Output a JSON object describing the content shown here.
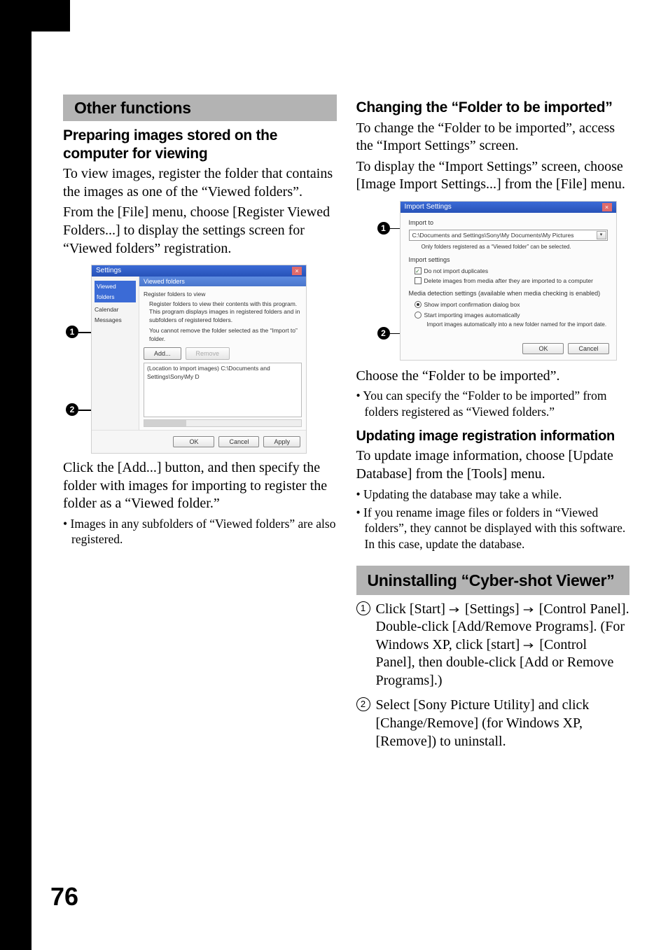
{
  "pageNumber": "76",
  "left": {
    "sectionTitle": "Other functions",
    "subTitle": "Preparing images stored on the computer for viewing",
    "para1": "To view images, register the folder that contains the images as one of the “Viewed folders”.",
    "para2": "From the [File] menu, choose [Register Viewed Folders...] to display the settings screen for “Viewed folders” registration.",
    "para3": "Click the [Add...] button, and then specify the folder with images for importing to register the folder as a “Viewed folder.”",
    "bullet1": "Images in any subfolders of “Viewed folders” are also registered.",
    "shot": {
      "title": "Settings",
      "sidebar": {
        "sel": "Viewed folders",
        "item1": "Calendar",
        "item2": "Messages"
      },
      "panelHead": "Viewed folders",
      "groupTitle": "Register folders to view",
      "desc1": "Register folders to view their contents with this program.",
      "desc2": "This program displays images in registered folders and in subfolders of registered folders.",
      "desc3": "You cannot remove the folder selected as the “Import to” folder.",
      "addBtn": "Add...",
      "removeBtn": "Remove",
      "locationLabel": "(Location to import images) C:\\Documents and Settings\\Sony\\My D",
      "okBtn": "OK",
      "cancelBtn": "Cancel",
      "applyBtn": "Apply"
    }
  },
  "right": {
    "sub1": "Changing the “Folder to be imported”",
    "para1a": "To change the “Folder to be imported”, access the “Import Settings” screen.",
    "para1b": "To display the “Import Settings” screen, choose [Image Import Settings...] from the [File] menu.",
    "shot": {
      "title": "Import Settings",
      "importTo": "Import to",
      "path": "C:\\Documents and Settings\\Sony\\My Documents\\My Pictures",
      "note": "Only folders registered as a “Viewed folder” can be selected.",
      "importSettings": "Import settings",
      "chk1": "Do not import duplicates",
      "chk2": "Delete images from media after they are imported to a computer",
      "mediaDetect": "Media detection settings (available when media checking is enabled)",
      "radio1": "Show import confirmation dialog box",
      "radio2": "Start importing images automatically",
      "radio2note": "Import images automatically into a new folder named for the import date.",
      "okBtn": "OK",
      "cancelBtn": "Cancel"
    },
    "para2": "Choose the “Folder to be imported”.",
    "bullet2": "You can specify the “Folder to be imported” from folders registered as “Viewed folders.”",
    "sub2": "Updating image registration information",
    "para3": "To update image information, choose [Update Database] from the [Tools] menu.",
    "bullet3a": "Updating the database may take a while.",
    "bullet3b": "If you rename image files or folders in “Viewed folders”, they cannot be displayed with this software. In this case, update the database.",
    "sectionTitle2": "Uninstalling “Cyber-shot Viewer”",
    "step1a": "Click [Start] ",
    "step1b": " [Settings] ",
    "step1c": " [Control Panel]. Double-click [Add/Remove Programs]. (For Windows XP, click [start] ",
    "step1d": " [Control Panel], then double-click [Add or Remove Programs].)",
    "step2": "Select [Sony Picture Utility] and click [Change/Remove] (for Windows XP, [Remove]) to uninstall."
  }
}
